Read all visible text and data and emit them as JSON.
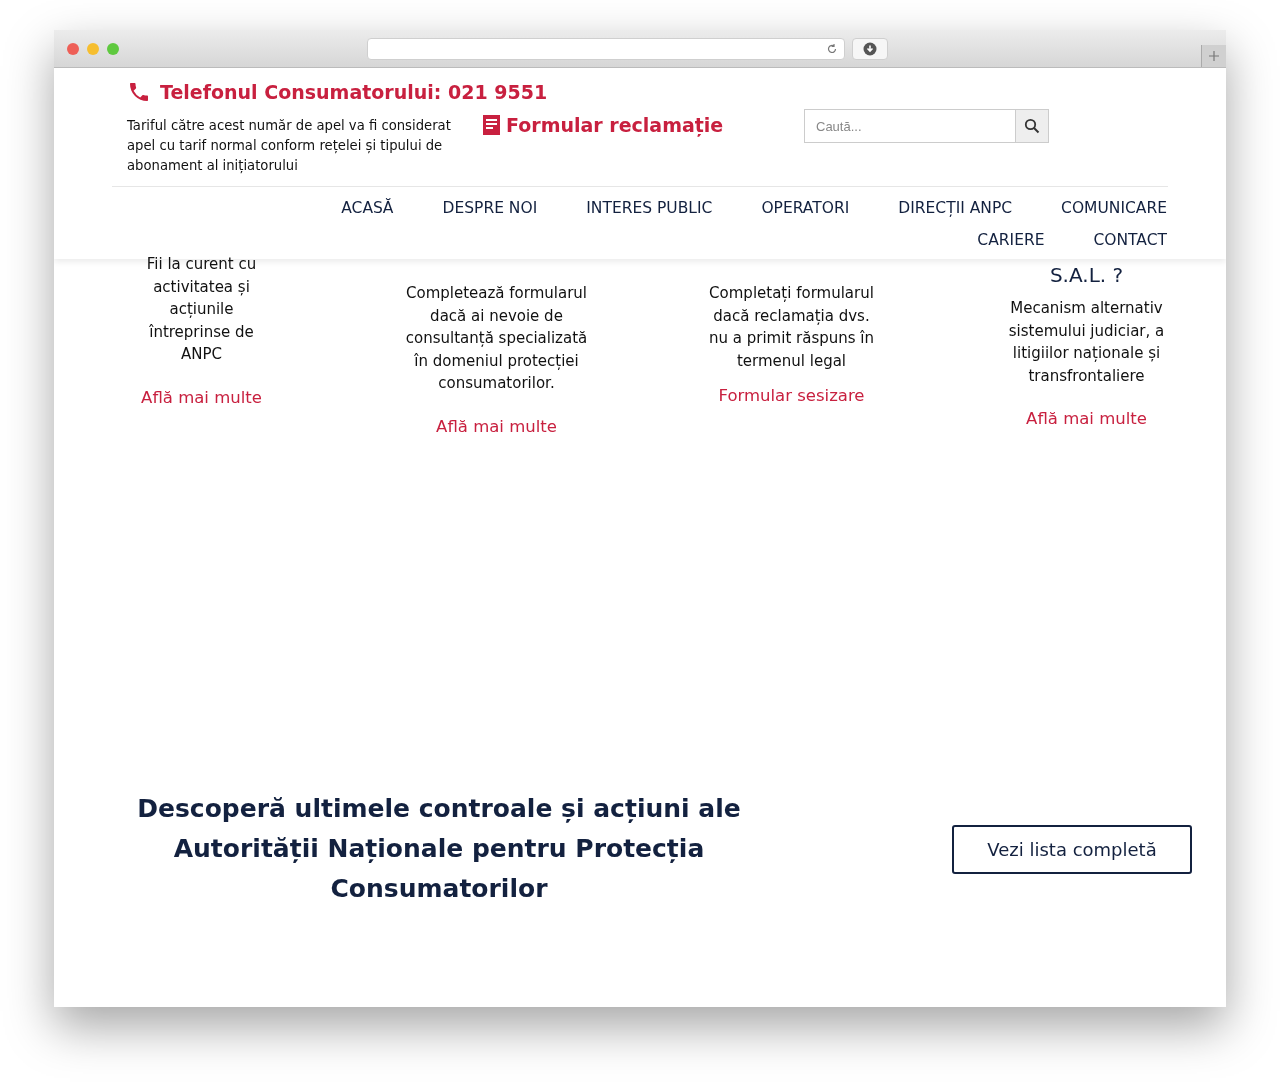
{
  "header": {
    "phone": "Telefonul Consumatorului: 021 9551",
    "tariff_note": "Tariful către acest număr de apel va fi considerat apel cu tarif normal conform rețelei și tipului de abonament al inițiatorului",
    "complaint_link": "Formular reclamație",
    "search": {
      "placeholder": "Caută..."
    }
  },
  "nav": [
    "ACASĂ",
    "DESPRE NOI",
    "INTERES PUBLIC",
    "OPERATORI",
    "DIRECȚII ANPC",
    "COMUNICARE",
    "CARIERE",
    "CONTACT"
  ],
  "cards": [
    {
      "text": "Fii la curent cu activitatea și acțiunile întreprinse de ANPC",
      "link": "Află mai multe"
    },
    {
      "text": "Completează formularul dacă ai nevoie de consultanță specializată în domeniul protecției consumatorilor.",
      "link": "Află mai multe"
    },
    {
      "text": "Completați formularul dacă reclamația dvs. nu a primit răspuns în termenul legal",
      "link": "Formular sesizare"
    },
    {
      "title": "S.A.L. ?",
      "text": "Mecanism alternativ sistemului judiciar, a litigiilor naționale și transfrontaliere",
      "link": "Află mai multe"
    }
  ],
  "banner": {
    "heading": "Descoperă ultimele controale și acțiuni ale Autorității Naționale pentru Protecția Consumatorilor",
    "button": "Vezi lista completă"
  }
}
